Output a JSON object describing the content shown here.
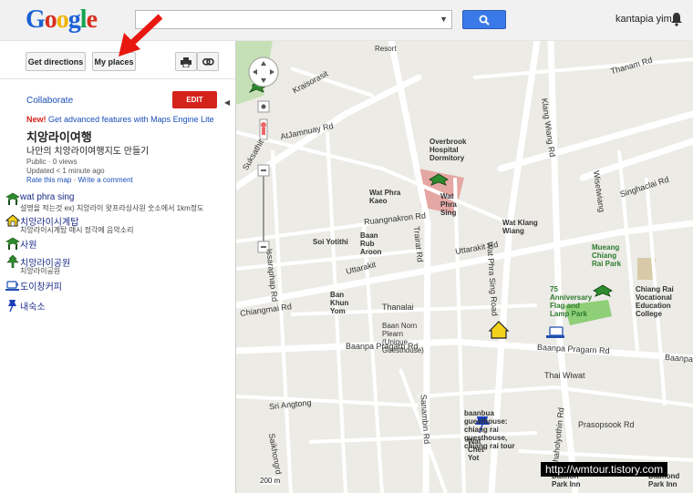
{
  "header": {
    "logo": "Google",
    "search_value": "",
    "user_name": "kantapia yim"
  },
  "panel": {
    "get_directions": "Get directions",
    "my_places": "My places",
    "collaborate": "Collaborate",
    "edit": "EDIT",
    "new_label": "New!",
    "new_link": "Get advanced features with Maps Engine Lite",
    "map_title": "치앙라이여행",
    "map_subtitle": "나만의 치앙라이여행지도 만들기",
    "meta_views": "Public · 0 views",
    "meta_updated": "Updated < 1 minute ago",
    "rate": "Rate this map",
    "sep": " · ",
    "comment": "Write a comment",
    "places": [
      {
        "name": "wat phra sing",
        "desc": "설명을 적는것 ex) 치앙라이 왓프라싱사원 숫소에서 1km정도",
        "icon": "green-tree-icon"
      },
      {
        "name": "치앙라이시계탑",
        "desc": "치앙라이시계탑 매시 정각에 음악소리",
        "icon": "yellow-house-icon"
      },
      {
        "name": "사원",
        "desc": "",
        "icon": "green-tree-icon"
      },
      {
        "name": "치앙라이공원",
        "desc": "치앙라이공원",
        "icon": "green-tree-icon"
      },
      {
        "name": "도이창커피",
        "desc": "",
        "icon": "coffee-cup-icon"
      },
      {
        "name": "내숙소",
        "desc": "",
        "icon": "blue-pushpin-icon"
      }
    ]
  },
  "map": {
    "roads": {
      "kraisorasit": "Kraisorasit",
      "atjamnuay": "AtJamnuay Rd",
      "klang_wiang": "Klang Wiang Rd",
      "thanam": "Thanam Rd",
      "singhaclai": "Singhaclai Rd",
      "wisetwiang": "Wisetwiang",
      "ruangnakron": "Ruangnakron Rd",
      "trairat": "Trairat Rd",
      "uttarakit": "Uttarakit",
      "uttarakit_rd": "Uttarakit Rd",
      "chiangmai": "Chiangmai Rd",
      "thanalai": "Thanalai",
      "baanpa_left": "Baanpa Pragarn Rd",
      "baanpa_mid": "Baanpa Pragarn Rd",
      "baanpa_right": "Baanpa",
      "sri_angtong": "Sri Angtong",
      "issaraphap": "Issaraphap Rd",
      "suksathit": "Suksathit",
      "sanambin": "Sanambin Rd",
      "phaholyothin": "Phaholyothin Rd",
      "prasopsook": "Prasopsook Rd",
      "saikhong": "Saikhongrd",
      "thai_wiwat": "Thai Wiwat",
      "wat_phra_sing_road": "Wat Phra Sing Road"
    },
    "places": {
      "resort": "Resort",
      "overbrook": "Overbrook Hospital Dormitory",
      "wat_phra_kaeo": "Wat Phra Kaeo",
      "wat_phra_sing": "Wat Phra Sing",
      "wat_klang_wiang": "Wat Klang Wiang",
      "baan_rub_aroon": "Baan Rub Aroon",
      "soi_yotithi": "Soi Yotithi",
      "ban_khun_yom": "Ban Khun Yom",
      "baan_norn_plearn": "Baan Norn Plearn (Unique Guesthouse)",
      "mueang_park": "Mueang Chiang Rai Park",
      "flag_lamp": "75 Anniversary Flag and Lamp Park",
      "vocational": "Chiang Rai Vocational Education College",
      "baanbua": "baanbua guesthouse: chiang rai guesthouse, chiang rai tour",
      "wat_chet_yot": "Wat Chet Yot",
      "daimon": "Daimon Park Inn",
      "diamond": "Diamond Park Inn"
    },
    "scale": "200 m",
    "watermark": "http://wmtour.tistory.com"
  }
}
